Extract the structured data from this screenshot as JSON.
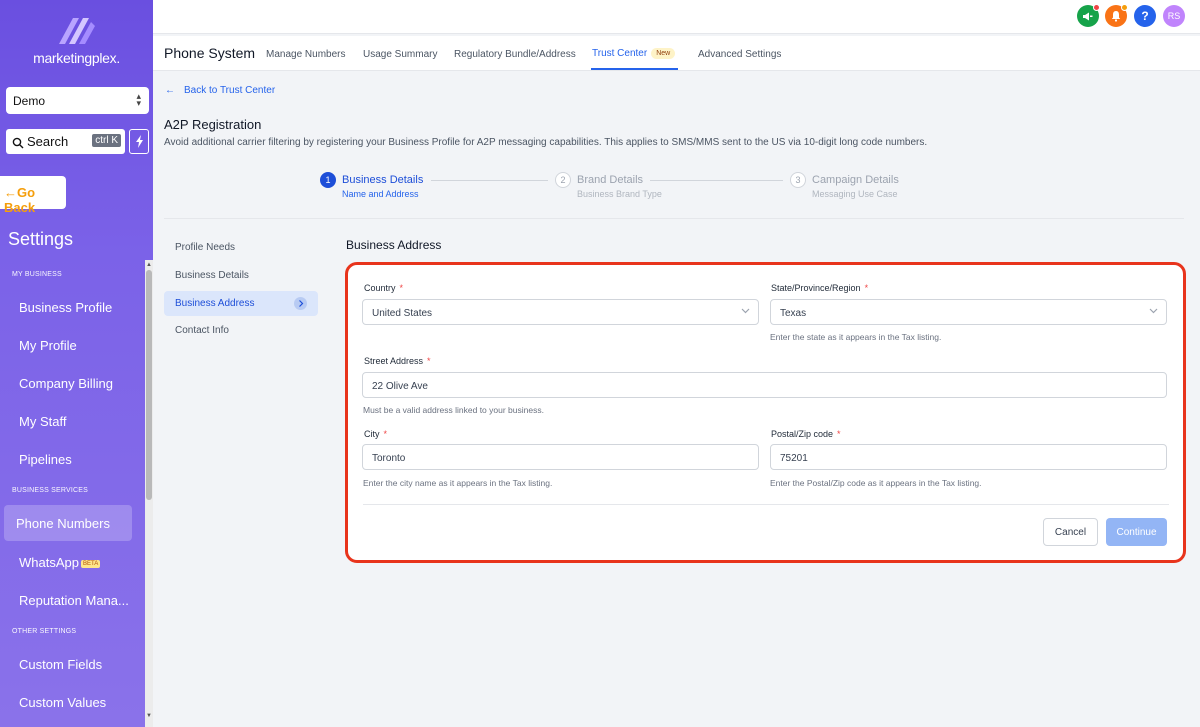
{
  "sidebar": {
    "logo_text": "marketingplex.",
    "location_select": "Demo",
    "search_placeholder": "Search",
    "search_shortcut": "ctrl K",
    "go_back": "Go Back",
    "settings_title": "Settings",
    "sections": {
      "my_business": "MY BUSINESS",
      "business_services": "BUSINESS SERVICES",
      "other_settings": "OTHER SETTINGS"
    },
    "items": [
      {
        "label": "Business Profile"
      },
      {
        "label": "My Profile"
      },
      {
        "label": "Company Billing"
      },
      {
        "label": "My Staff"
      },
      {
        "label": "Pipelines"
      },
      {
        "label": "Phone Numbers",
        "active": true
      },
      {
        "label": "WhatsApp",
        "badge": "BETA"
      },
      {
        "label": "Reputation Mana..."
      },
      {
        "label": "Custom Fields"
      },
      {
        "label": "Custom Values"
      }
    ]
  },
  "header": {
    "avatar_initials": "RS",
    "icons": [
      "megaphone-icon",
      "bell-icon",
      "help-icon"
    ]
  },
  "subnav": {
    "title": "Phone System",
    "tabs": [
      {
        "label": "Manage Numbers"
      },
      {
        "label": "Usage Summary"
      },
      {
        "label": "Regulatory Bundle/Address"
      },
      {
        "label": "Trust Center",
        "badge": "New",
        "active": true
      },
      {
        "label": "Advanced Settings"
      }
    ]
  },
  "main": {
    "back_link": "Back to Trust Center",
    "title": "A2P Registration",
    "description": "Avoid additional carrier filtering by registering your Business Profile for A2P messaging capabilities. This applies to SMS/MMS sent to the US via 10-digit long code numbers.",
    "steps": [
      {
        "number": "1",
        "title": "Business Details",
        "subtitle": "Name and Address",
        "active": true
      },
      {
        "number": "2",
        "title": "Brand Details",
        "subtitle": "Business Brand Type",
        "active": false
      },
      {
        "number": "3",
        "title": "Campaign Details",
        "subtitle": "Messaging Use Case",
        "active": false
      }
    ],
    "side_nav": [
      {
        "label": "Profile Needs"
      },
      {
        "label": "Business Details"
      },
      {
        "label": "Business Address",
        "active": true
      },
      {
        "label": "Contact Info"
      }
    ],
    "section_title": "Business Address",
    "form": {
      "country": {
        "label": "Country",
        "value": "United States"
      },
      "state": {
        "label": "State/Province/Region",
        "value": "Texas",
        "help": "Enter the state as it appears in the Tax listing."
      },
      "street": {
        "label": "Street Address",
        "value": "22 Olive Ave",
        "help": "Must be a valid address linked to your business."
      },
      "city": {
        "label": "City",
        "value": "Toronto",
        "help": "Enter the city name as it appears in the Tax listing."
      },
      "postal": {
        "label": "Postal/Zip code",
        "value": "75201",
        "help": "Enter the Postal/Zip code as it appears in the Tax listing."
      },
      "required_mark": "*",
      "cancel_label": "Cancel",
      "continue_label": "Continue"
    }
  },
  "colors": {
    "sidebar_top": "#6a4fe0",
    "primary": "#2563eb",
    "highlight_border": "#e8341c",
    "go_back": "#f59e0b"
  }
}
